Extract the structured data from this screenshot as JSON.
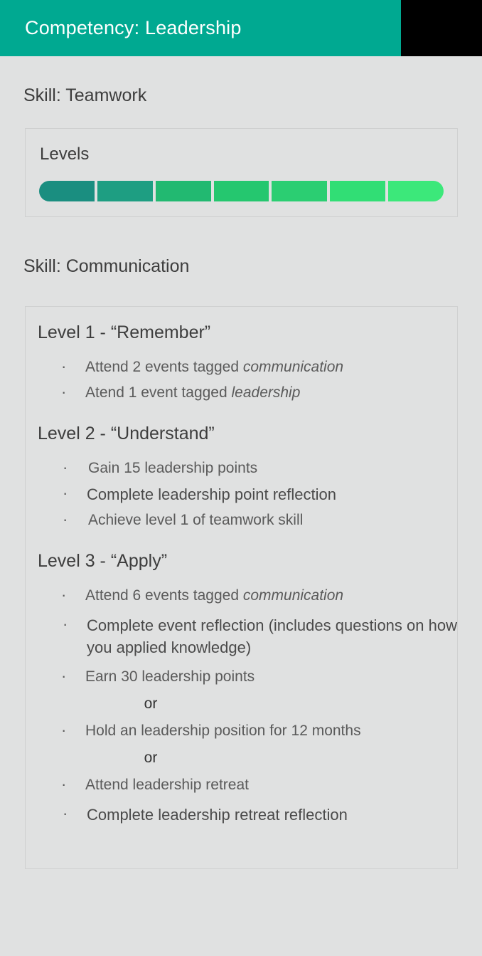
{
  "header": {
    "title": "Competency: Leadership",
    "accent_color": "#00a991",
    "filler_color": "#000000",
    "text_color": "#ffffff"
  },
  "page": {
    "background_color": "#e0e1e1",
    "text_color": "#5a5a5a",
    "heading_color": "#3d3d3d",
    "card_border_color": "#cfd0d0"
  },
  "teamwork": {
    "skill_heading": "Skill: Teamwork",
    "levels_label": "Levels",
    "level_segments": [
      {
        "level": 1,
        "color": "#1a8e80"
      },
      {
        "level": 2,
        "color": "#1e9e82"
      },
      {
        "level": 3,
        "color": "#22b971"
      },
      {
        "level": 4,
        "color": "#25c76f"
      },
      {
        "level": 5,
        "color": "#2bce72"
      },
      {
        "level": 6,
        "color": "#31de75"
      },
      {
        "level": 7,
        "color": "#3ce87a"
      }
    ]
  },
  "communication": {
    "skill_heading": "Skill: Communication",
    "levels": [
      {
        "title": "Level 1 - “Remember”",
        "requirements": [
          {
            "text": "Attend 2 events tagged ",
            "em": "communication",
            "style": "normal"
          },
          {
            "text": "Atend 1 event tagged ",
            "em": "leadership",
            "style": "normal"
          }
        ]
      },
      {
        "title": "Level 2 - “Understand”",
        "requirements": [
          {
            "text": "Gain 15 leadership points",
            "em": "",
            "style": "indent-more"
          },
          {
            "text": "Complete leadership point reflection",
            "em": "",
            "style": "strong"
          },
          {
            "text": "Achieve level 1 of teamwork skill",
            "em": "",
            "style": "indent-more"
          }
        ]
      },
      {
        "title": "Level 3 - “Apply”",
        "requirements": [
          {
            "text": "Attend 6 events tagged ",
            "em": "communication",
            "style": "normal"
          },
          {
            "text": "Complete event reflection (includes questions on how you applied knowledge)",
            "em": "",
            "style": "strong"
          },
          {
            "text": "Earn 30 leadership points",
            "em": "",
            "style": "normal"
          }
        ],
        "or_label_1": "or",
        "requirements_alt_1": [
          {
            "text": "Hold an leadership position for 12 months",
            "em": "",
            "style": "normal"
          }
        ],
        "or_label_2": "or",
        "requirements_alt_2": [
          {
            "text": "Attend leadership retreat",
            "em": "",
            "style": "normal"
          },
          {
            "text": "Complete leadership retreat reflection",
            "em": "",
            "style": "strong"
          }
        ]
      }
    ]
  }
}
